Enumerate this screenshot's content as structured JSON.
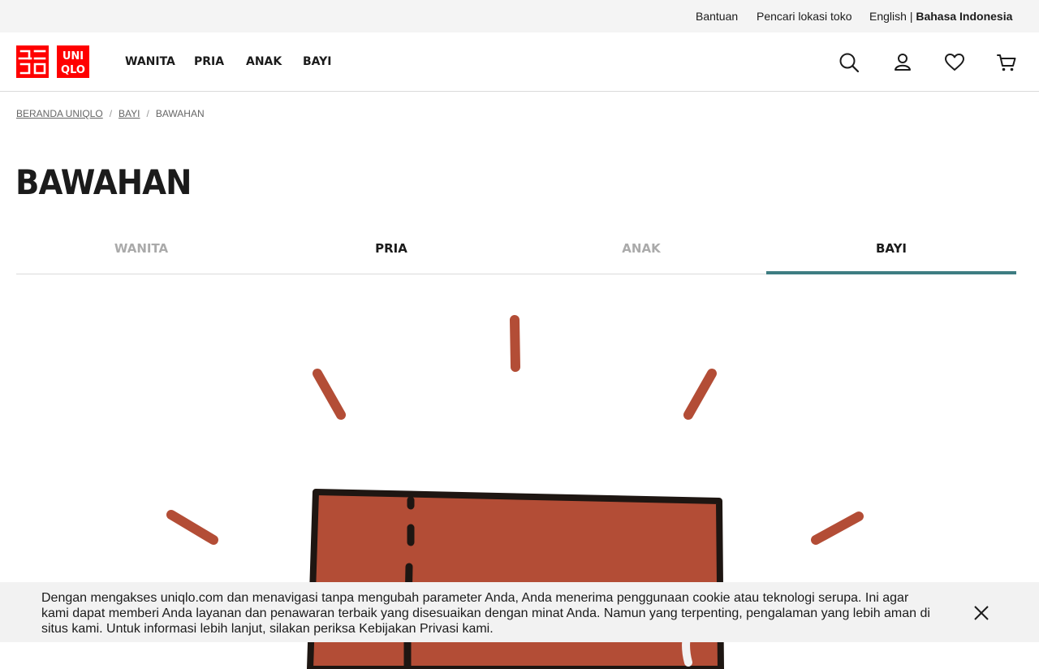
{
  "utility_bar": {
    "help": "Bantuan",
    "store_locator": "Pencari lokasi toko",
    "lang_english": "English",
    "lang_separator": "|",
    "lang_indonesian": "Bahasa Indonesia"
  },
  "brand": {
    "logo_text_left": "ユニクロ",
    "logo_text_right": "UNI QLO",
    "brand_color": "#ff0000"
  },
  "nav": {
    "items": [
      "WANITA",
      "PRIA",
      "ANAK",
      "BAYI"
    ]
  },
  "header_icons": [
    "search-icon",
    "user-icon",
    "heart-icon",
    "cart-icon"
  ],
  "breadcrumb": {
    "items": [
      "BERANDA UNIQLO",
      "BAYI",
      "BAWAHAN"
    ],
    "separator": "/"
  },
  "page_title": "BAWAHAN",
  "tabs": {
    "items": [
      "WANITA",
      "PRIA",
      "ANAK",
      "BAYI"
    ],
    "active": "BAYI",
    "active_color": "#3e7d82"
  },
  "banner": {
    "illustration": "pants-with-sparkle-lines",
    "pants_color": "#b34d36"
  },
  "cookie": {
    "text": "Dengan mengakses uniqlo.com dan menavigasi tanpa mengubah parameter Anda, Anda menerima penggunaan cookie atau teknologi serupa. Ini agar kami dapat memberi Anda layanan dan penawaran terbaik yang disesuaikan dengan minat Anda. Namun yang terpenting, pengalaman yang lebih aman di situs kami. Untuk informasi lebih lanjut, silakan periksa Kebijakan Privasi kami.",
    "close_icon": "close-icon"
  }
}
